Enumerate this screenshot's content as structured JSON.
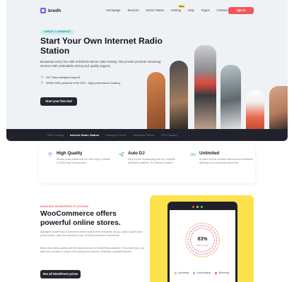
{
  "header": {
    "brand": "bredh",
    "nav": [
      "Homepage",
      "Services",
      "Server Status",
      "Hosting",
      "Help",
      "Pages",
      "Contact us"
    ],
    "new_badge": "New",
    "sign_in": "sign in"
  },
  "hero": {
    "badge": "CREDIT & WEBFEST",
    "title": "Start Your Own Internet Radio Station",
    "description": "Broadcast worry-free with unlimited internet radio hosting. We provide premium streaming services with unbeatable pricing and quality support.",
    "checks": [
      "24/7 fully managed support.",
      "NVMe SSD-powered KVM VPS - high performance hosting."
    ],
    "cta": "Start your free trial"
  },
  "tabs": {
    "items": [
      "Web Hosting",
      "Internet Radio Station",
      "Managed Server",
      "Dedicated Server",
      "VPS Hosting"
    ],
    "active_index": 1
  },
  "features": [
    {
      "title": "High Quality",
      "desc": "Stream at any bitrate with our wide range of bitrate & SHOUTcast hosting plans.",
      "icon": "wifi-icon"
    },
    {
      "title": "Auto DJ",
      "desc": "Keep it fresh broadcasting with our complete automation platform. No software required.",
      "icon": "send-icon"
    },
    {
      "title": "Unlimited",
      "desc": "All plans include unlimited listeners and bandwidth, allowing you to broadcast stress-free.",
      "icon": "infinity-icon"
    }
  ],
  "woo": {
    "eyebrow": "MANAGED WORDPRESS PLATFORM",
    "title": "WooCommerce offers powerful online stores.",
    "p1": "Managed WordPress Ecommerce offers hassle-free enterprise set-up, built-in speed and performance, plus free access to over all WooCommerce extensions.",
    "p2": "Build client sites quickly with the latest version of WordPress installed. From there you can start from scratch or play in the pricing from dozens of flexible, scalable themes.",
    "cta": "See all WordPress prices"
  },
  "device": {
    "percent": "83%",
    "sublabel": "Daily Growth",
    "legend": [
      "Uploading",
      "Downloading",
      "Streaming"
    ],
    "colors": {
      "uploading": "#f4b24a",
      "downloading": "#b98cf3",
      "streaming": "#f2555d"
    }
  },
  "colors": {
    "accent": "#f2555d",
    "dark": "#22252d",
    "yellow": "#fde24c"
  }
}
